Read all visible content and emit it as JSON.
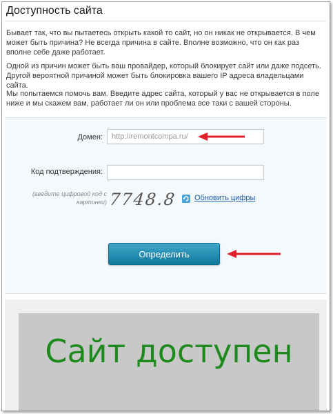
{
  "page": {
    "title": "Доступность сайта",
    "paragraphs": [
      "Бывает так, что вы пытаетесь открыть какой то сайт, но он никак не открывается. В чем может быть причина? Не всегда причина в сайте. Вполне возможно, что он как раз вполне себе даже работает.",
      "Одной из причин может быть ваш провайдер, который блокирует сайт или даже подсеть. Другой вероятной причиной может быть блокировка вашего IP адреса владельцами сайта.",
      "Мы попытаемся помочь вам. Введите адрес сайта, который у вас не открывается в поле ниже и мы скажем вам, работает ли он или проблема все таки с вашей  стороны."
    ]
  },
  "form": {
    "domain_label": "Домен:",
    "domain_value": "http://remontcompa.ru/",
    "code_label": "Код подтверждения:",
    "code_value": "",
    "captcha_hint": "(введите цифровой код с картинки)",
    "captcha_text": "7748.8",
    "refresh_label": "Обновить цифры",
    "submit_label": "Определить"
  },
  "result": {
    "text": "Сайт доступен"
  },
  "colors": {
    "accent_arrow": "#e0202a",
    "button": "#1b86ad",
    "result_text": "#1e8a1e",
    "link": "#1a5ea8"
  }
}
